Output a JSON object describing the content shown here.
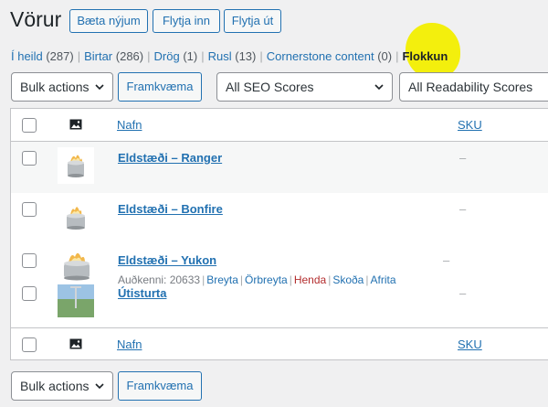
{
  "header": {
    "title": "Vörur",
    "buttons": [
      "Bæta nýjum",
      "Flytja inn",
      "Flytja út"
    ]
  },
  "filters": [
    {
      "label": "Í heild",
      "count": "(287)"
    },
    {
      "label": "Birtar",
      "count": "(286)"
    },
    {
      "label": "Drög",
      "count": "(1)"
    },
    {
      "label": "Rusl",
      "count": "(13)"
    },
    {
      "label": "Cornerstone content",
      "count": "(0)"
    }
  ],
  "filters_current": "Flokkun",
  "highlight_color": "#f2ee00",
  "tablenav_top": {
    "bulk_actions": "Bulk actions",
    "apply": "Framkvæma",
    "seo_filter": "All SEO Scores",
    "readability_filter": "All Readability Scores"
  },
  "table": {
    "columns": {
      "name": "Nafn",
      "sku": "SKU"
    },
    "rows": [
      {
        "name": "Eldstæði – Ranger",
        "sku": "–"
      },
      {
        "name": "Eldstæði – Bonfire",
        "sku": "–"
      },
      {
        "name": "Eldstæði – Yukon",
        "sku": "–",
        "row_actions": {
          "id_text": "Auðkenni: 20633",
          "actions": [
            "Breyta",
            "Örbreyta",
            "Henda",
            "Skoða",
            "Afrita"
          ]
        }
      },
      {
        "name": "Útisturta",
        "sku": "–"
      }
    ]
  },
  "tablenav_bottom": {
    "bulk_actions": "Bulk actions",
    "apply": "Framkvæma"
  },
  "colors": {
    "link": "#2271b1",
    "delete": "#b32d2e",
    "background": "#f0f0f1"
  }
}
